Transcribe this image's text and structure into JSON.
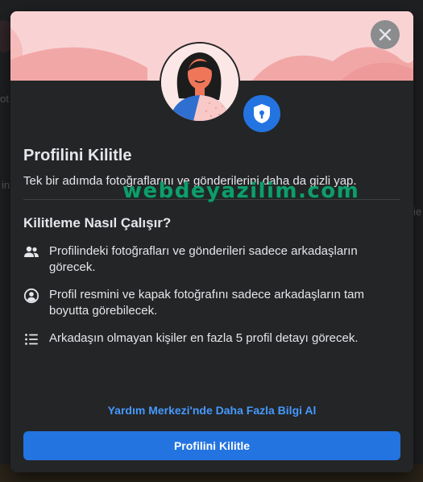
{
  "background": {
    "left_fragment_1": "ot",
    "left_fragment_2": "in",
    "right_fragment": "ie"
  },
  "modal": {
    "close_icon": "close-icon",
    "title": "Profilini Kilitle",
    "subtitle": "Tek bir adımda fotoğraflarını ve gönderilerini daha da gizli yap.",
    "section_title": "Kilitleme Nasıl Çalışır?",
    "items": [
      {
        "icon": "friends-icon",
        "text": "Profilindeki fotoğrafları ve gönderileri sadece arkadaşların görecek."
      },
      {
        "icon": "profile-circle-icon",
        "text": "Profil resmini ve kapak fotoğrafını sadece arkadaşların tam boyutta görebilecek."
      },
      {
        "icon": "list-icon",
        "text": "Arkadaşın olmayan kişiler en fazla 5 profil detayı görecek."
      }
    ],
    "help_link": "Yardım Merkezi'nde Daha Fazla Bilgi Al",
    "primary_button": "Profilini Kilitle"
  },
  "watermark": "webdeyazilim.com",
  "colors": {
    "modal_bg": "#242526",
    "accent": "#2374e1",
    "link": "#4599ff",
    "banner": "#f9d3d3",
    "watermark": "#0f9d6b"
  }
}
